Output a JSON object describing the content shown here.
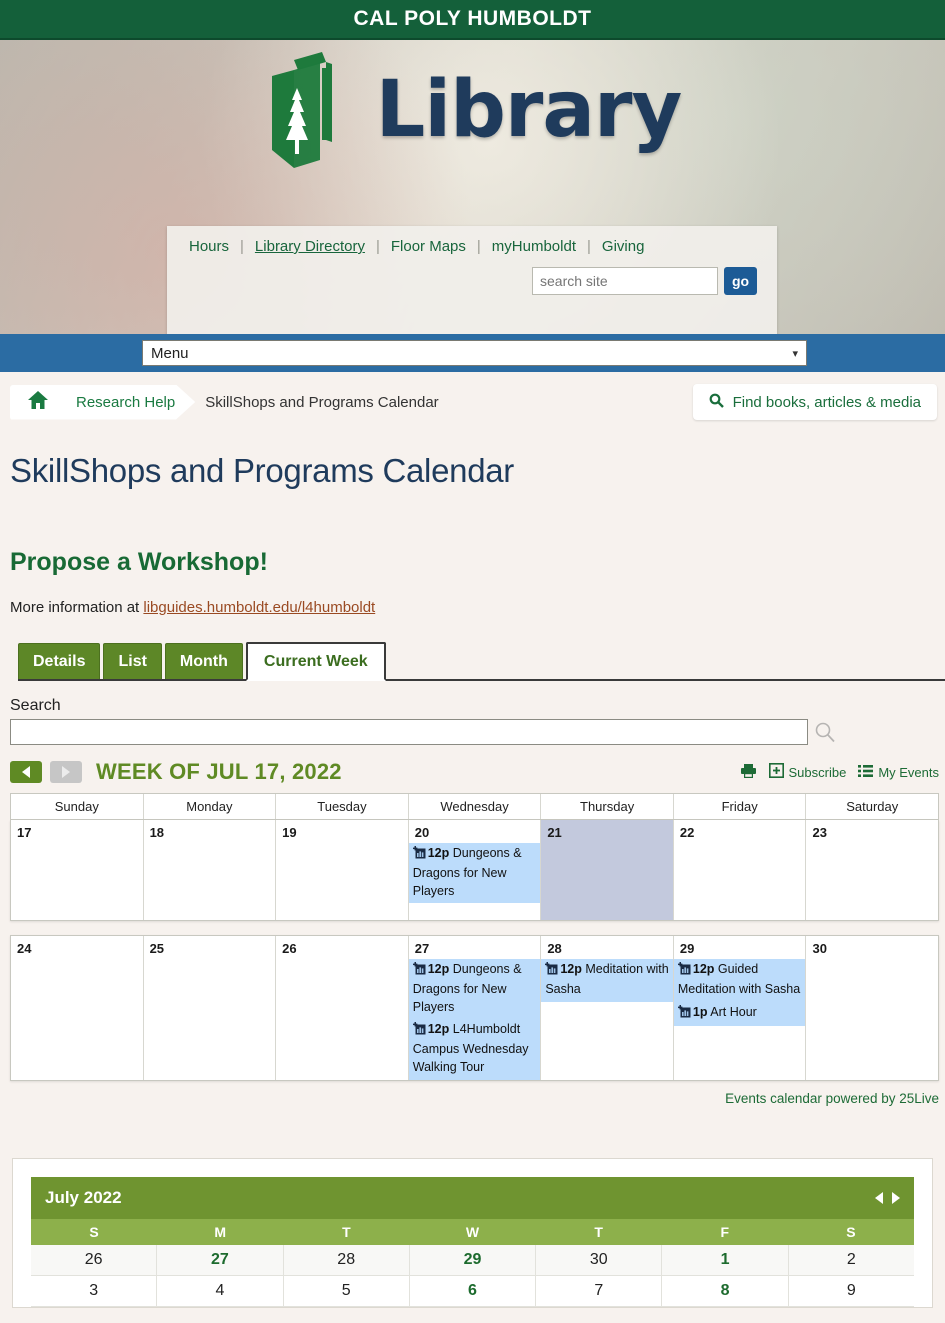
{
  "university_bar": {
    "wordmark_part1": "CAL POLY ",
    "wordmark_part2": "HUMBOLDT"
  },
  "banner": {
    "logo_text": "Library",
    "logo_icon": "book-tree-logo-icon",
    "util_links": [
      {
        "label": "Hours",
        "underlined": false
      },
      {
        "label": "Library Directory",
        "underlined": true
      },
      {
        "label": "Floor Maps",
        "underlined": false
      },
      {
        "label": "myHumboldt",
        "underlined": false
      },
      {
        "label": "Giving",
        "underlined": false
      }
    ],
    "search_placeholder": "search site",
    "search_value": "",
    "go_label": "go"
  },
  "menu_bar": {
    "label": "Menu",
    "chevron": "⌄"
  },
  "breadcrumb": {
    "home_icon": "home-icon",
    "parent": "Research Help",
    "current": "SkillShops and Programs Calendar"
  },
  "find_books": {
    "label": "Find books, articles & media",
    "icon": "search-icon"
  },
  "page": {
    "title": "SkillShops and Programs Calendar",
    "propose_heading": "Propose a Workshop!",
    "more_info_prefix": "More information at ",
    "more_info_link": "libguides.humboldt.edu/l4humboldt"
  },
  "tabs": [
    {
      "label": "Details",
      "active": false
    },
    {
      "label": "List",
      "active": false
    },
    {
      "label": "Month",
      "active": false
    },
    {
      "label": "Current Week",
      "active": true
    }
  ],
  "search": {
    "label": "Search",
    "value": "",
    "placeholder": "",
    "icon": "magnifier-icon"
  },
  "calendar_toolbar": {
    "prev_icon": "left-triangle-icon",
    "next_icon": "right-triangle-icon",
    "week_title": "WEEK OF JUL 17, 2022",
    "print_icon": "printer-icon",
    "subscribe_label": "Subscribe",
    "subscribe_icon": "plus-box-icon",
    "my_events_label": "My Events",
    "my_events_icon": "list-icon"
  },
  "calendar": {
    "day_headers": [
      "Sunday",
      "Monday",
      "Tuesday",
      "Wednesday",
      "Thursday",
      "Friday",
      "Saturday"
    ],
    "weeks": [
      {
        "days": [
          {
            "num": "17",
            "today": false,
            "events": []
          },
          {
            "num": "18",
            "today": false,
            "events": []
          },
          {
            "num": "19",
            "today": false,
            "events": []
          },
          {
            "num": "20",
            "today": false,
            "events": [
              {
                "time": "12p",
                "title": "Dungeons & Dragons for New Players"
              }
            ]
          },
          {
            "num": "21",
            "today": true,
            "events": []
          },
          {
            "num": "22",
            "today": false,
            "events": []
          },
          {
            "num": "23",
            "today": false,
            "events": []
          }
        ]
      },
      {
        "days": [
          {
            "num": "24",
            "today": false,
            "events": []
          },
          {
            "num": "25",
            "today": false,
            "events": []
          },
          {
            "num": "26",
            "today": false,
            "events": []
          },
          {
            "num": "27",
            "today": false,
            "events": [
              {
                "time": "12p",
                "title": "Dungeons & Dragons for New Players"
              },
              {
                "time": "12p",
                "title": "L4Humboldt Campus Wednesday Walking Tour"
              }
            ]
          },
          {
            "num": "28",
            "today": false,
            "events": [
              {
                "time": "12p",
                "title": "Meditation with Sasha"
              }
            ]
          },
          {
            "num": "29",
            "today": false,
            "events": [
              {
                "time": "12p",
                "title": "Guided Meditation with Sasha"
              },
              {
                "time": "1p",
                "title": "Art Hour"
              }
            ]
          },
          {
            "num": "30",
            "today": false,
            "events": []
          }
        ]
      }
    ],
    "powered_by": "Events calendar powered by 25Live"
  },
  "mini_calendar": {
    "title": "July 2022",
    "prev_icon": "left-triangle-icon",
    "next_icon": "right-triangle-icon",
    "dow": [
      "S",
      "M",
      "T",
      "W",
      "T",
      "F",
      "S"
    ],
    "rows": [
      {
        "other_month": true,
        "cells": [
          {
            "n": "26",
            "hl": false
          },
          {
            "n": "27",
            "hl": true
          },
          {
            "n": "28",
            "hl": false
          },
          {
            "n": "29",
            "hl": true
          },
          {
            "n": "30",
            "hl": false
          },
          {
            "n": "1",
            "hl": true
          },
          {
            "n": "2",
            "hl": false
          }
        ]
      },
      {
        "other_month": false,
        "cells": [
          {
            "n": "3",
            "hl": false
          },
          {
            "n": "4",
            "hl": false
          },
          {
            "n": "5",
            "hl": false
          },
          {
            "n": "6",
            "hl": true
          },
          {
            "n": "7",
            "hl": false
          },
          {
            "n": "8",
            "hl": true
          },
          {
            "n": "9",
            "hl": false
          }
        ]
      }
    ]
  },
  "colors": {
    "university_green": "#14603a",
    "tab_green": "#5d8727",
    "accent_green": "#5f8a24",
    "link_green": "#1a6e3c",
    "event_blue": "#bcdcfb",
    "today_gray": "#c3c9dd",
    "title_navy": "#1f3b5c",
    "link_brown": "#9a4a22",
    "mini_header_green": "#6f9430",
    "page_bg": "#f7f2ee"
  }
}
